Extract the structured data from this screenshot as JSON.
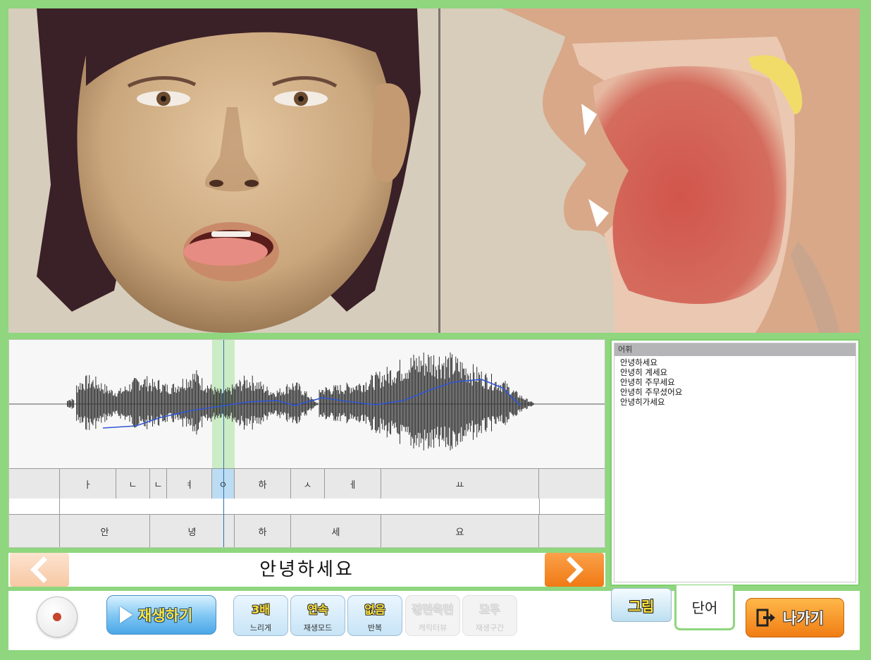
{
  "vocabulary": {
    "header": "어휘",
    "items": [
      "안녕하세요",
      "안녕히 계세요",
      "안녕히 주무세요",
      "안녕히 주무셨어요",
      "안녕히가세요"
    ]
  },
  "segments": {
    "phonemes": [
      "",
      "ㅏ",
      "ㄴ",
      "ㄴ",
      "ㅕ",
      "ㅇ",
      "하",
      "ㅅ",
      "ㅔ",
      "ㅛ",
      ""
    ],
    "syllables": [
      "",
      "안",
      "녕",
      "하",
      "세",
      "요",
      ""
    ],
    "selected_phoneme_index": 5
  },
  "word_bar": {
    "current_word": "안녕하세요"
  },
  "controls": {
    "play_label": "재생하기",
    "speed": {
      "value": "3배",
      "caption": "느리게"
    },
    "play_mode": {
      "value": "연속",
      "caption": "재생모드"
    },
    "repeat": {
      "value": "없음",
      "caption": "반복"
    },
    "character_view": {
      "value": "정면측면",
      "caption": "캐릭터뷰"
    },
    "play_range": {
      "value": "모두",
      "caption": "재생구간"
    },
    "tab_picture": "그림",
    "tab_word": "단어",
    "exit_label": "나가기"
  },
  "icons": {
    "record": "record-icon",
    "play": "play-triangle-icon",
    "prev": "chevron-left-icon",
    "next": "chevron-right-icon",
    "exit": "exit-door-icon"
  },
  "colors": {
    "frame_green": "#8fd67e",
    "waveform": "#333333",
    "pitch_contour": "#2f56d6",
    "selection_highlight": "#bfe8b8",
    "next_button": "#f07a14",
    "play_button": "#5fb4ec"
  }
}
